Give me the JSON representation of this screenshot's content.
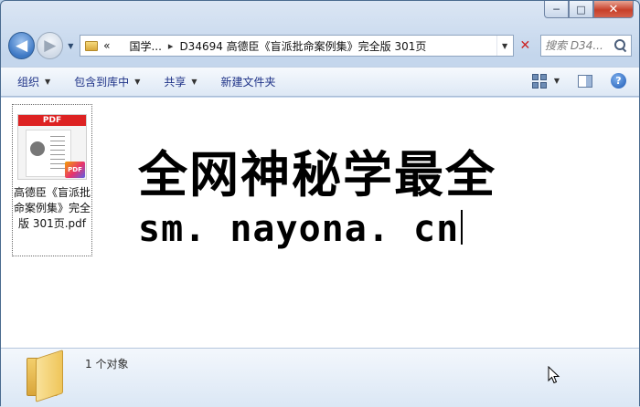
{
  "window": {
    "caption": {
      "minimize": "─",
      "maximize": "□",
      "close": "✕"
    }
  },
  "nav": {
    "back_icon": "◀",
    "forward_icon": "▶",
    "history_icon": "▼",
    "address": {
      "overflow": "«",
      "segments": [
        "国学...",
        "D34694 高德臣《盲派批命案例集》完全版 301页"
      ],
      "separator": "▸",
      "dropdown_icon": "▼"
    },
    "refresh_icon": "✕",
    "search": {
      "placeholder": "搜索 D34..."
    }
  },
  "toolbar": {
    "items": [
      {
        "label": "组织",
        "has_dropdown": true
      },
      {
        "label": "包含到库中",
        "has_dropdown": true
      },
      {
        "label": "共享",
        "has_dropdown": true
      },
      {
        "label": "新建文件夹",
        "has_dropdown": false
      }
    ],
    "dropdown_icon": "▼",
    "help_icon": "?"
  },
  "files": [
    {
      "name": "高德臣《盲派批命案例集》完全版 301页.pdf",
      "thumb_header": "PDF",
      "badge": "PDF"
    }
  ],
  "overlay": {
    "line1": "全网神秘学最全",
    "line2": "sm. nayona. cn"
  },
  "details": {
    "count_text": "1 个对象"
  },
  "colors": {
    "accent": "#1e3287",
    "close_button": "#c7402a",
    "pdf_red": "#dd2222"
  }
}
